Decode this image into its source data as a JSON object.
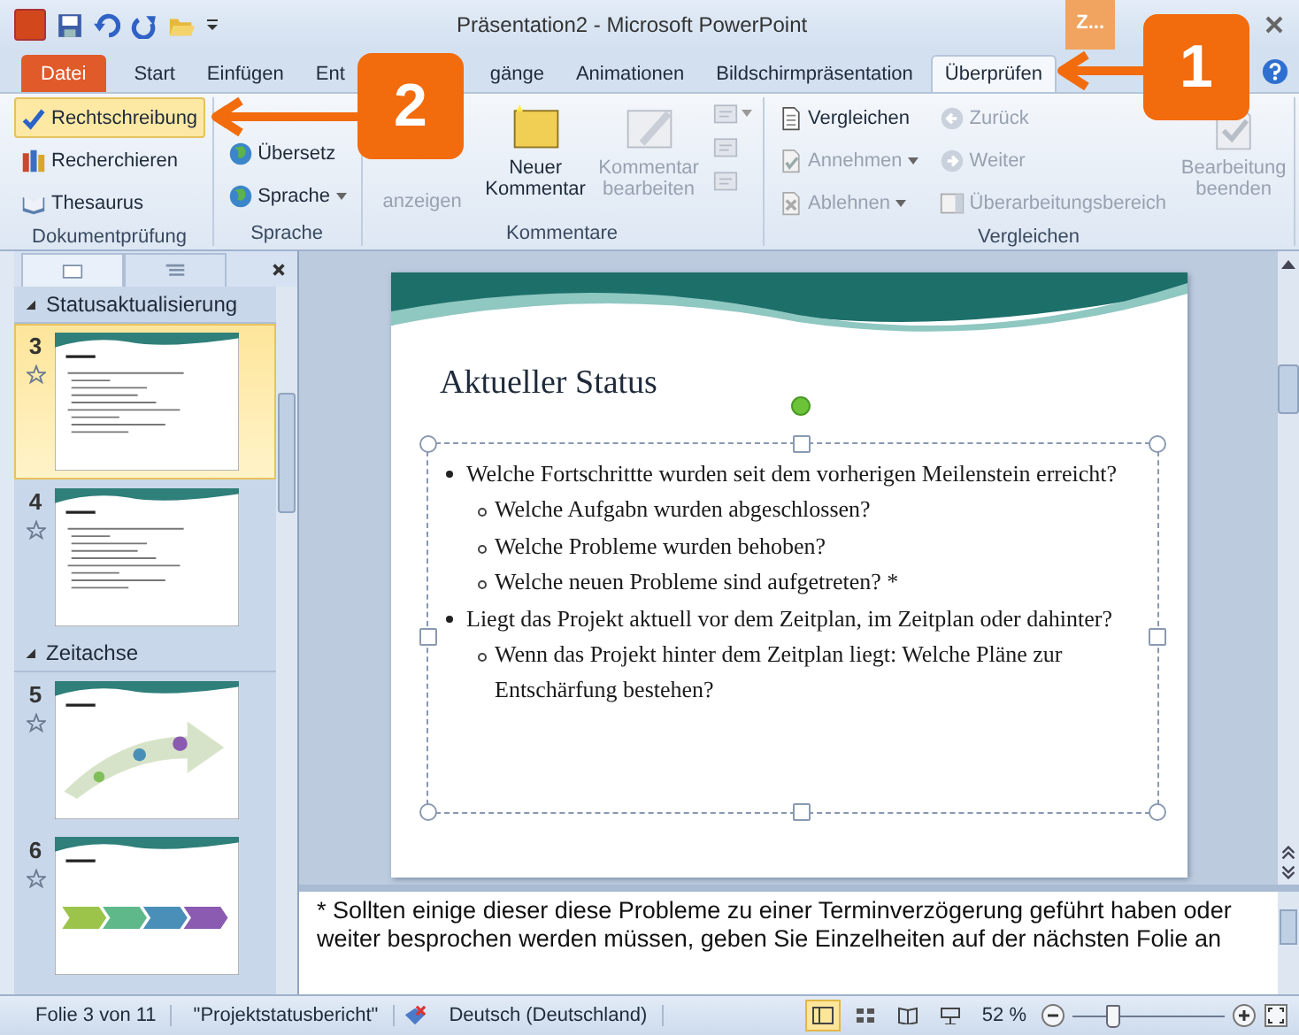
{
  "window": {
    "title": "Präsentation2 - Microsoft PowerPoint",
    "user_badge": "Z..."
  },
  "tabs": [
    {
      "label": "Datei",
      "kind": "file",
      "selected": false
    },
    {
      "label": "Start",
      "kind": "tab",
      "selected": false
    },
    {
      "label": "Einfügen",
      "kind": "tab",
      "selected": false
    },
    {
      "label": "Ent",
      "kind": "tab",
      "selected": false
    },
    {
      "label": "gänge",
      "kind": "tab",
      "selected": false
    },
    {
      "label": "Animationen",
      "kind": "tab",
      "selected": false
    },
    {
      "label": "Bildschirmpräsentation",
      "kind": "tab",
      "selected": false
    },
    {
      "label": "Überprüfen",
      "kind": "tab",
      "selected": true
    }
  ],
  "ribbon_groups": [
    {
      "title": "Dokumentprüfung",
      "columns": [
        [
          {
            "label": "Rechtschreibung",
            "kind": "small",
            "disabled": false,
            "highlighted": true,
            "dropdown": false
          },
          {
            "label": "Recherchieren",
            "kind": "small",
            "disabled": false,
            "highlighted": false,
            "dropdown": false
          },
          {
            "label": "Thesaurus",
            "kind": "small",
            "disabled": false,
            "highlighted": false,
            "dropdown": false
          }
        ]
      ]
    },
    {
      "title": "Sprache",
      "columns": [
        [
          {
            "label": "Übersetz",
            "kind": "small",
            "disabled": false,
            "highlighted": false,
            "dropdown": false
          },
          {
            "label": "Sprache",
            "kind": "small",
            "disabled": false,
            "highlighted": false,
            "dropdown": true
          }
        ]
      ]
    },
    {
      "title": "Kommentare",
      "columns": [
        [
          {
            "label": "anzeigen",
            "kind": "large",
            "disabled": true
          }
        ],
        [
          {
            "label": "Neuer Kommentar",
            "kind": "large",
            "disabled": false
          }
        ],
        [
          {
            "label": "Kommentar bearbeiten",
            "kind": "large",
            "disabled": true
          }
        ],
        [
          {
            "kind": "icon",
            "disabled": true,
            "dropdown": true
          },
          {
            "kind": "icon",
            "disabled": true,
            "dropdown": false
          },
          {
            "kind": "icon",
            "disabled": true,
            "dropdown": false
          }
        ]
      ]
    },
    {
      "title": "Vergleichen",
      "columns": [
        [
          {
            "label": "Vergleichen",
            "kind": "small",
            "disabled": false,
            "highlighted": false,
            "dropdown": false
          },
          {
            "label": "Annehmen",
            "kind": "small",
            "disabled": true,
            "highlighted": false,
            "dropdown": true
          },
          {
            "label": "Ablehnen",
            "kind": "small",
            "disabled": true,
            "highlighted": false,
            "dropdown": true
          }
        ],
        [
          {
            "label": "Zurück",
            "kind": "small",
            "disabled": true,
            "highlighted": false,
            "dropdown": false
          },
          {
            "label": "Weiter",
            "kind": "small",
            "disabled": true,
            "highlighted": false,
            "dropdown": false
          },
          {
            "label": "Überarbeitungsbereich",
            "kind": "small",
            "disabled": true,
            "highlighted": false,
            "dropdown": false
          }
        ],
        [
          {
            "label": "Bearbeitung beenden",
            "kind": "large",
            "disabled": true
          }
        ]
      ]
    }
  ],
  "slide_panel": {
    "sections": [
      {
        "title": "Statusaktualisierung",
        "expanded": true,
        "slides": [
          {
            "number": "3",
            "kind": "bullets",
            "selected": true
          },
          {
            "number": "4",
            "kind": "bullets",
            "selected": false
          }
        ]
      },
      {
        "title": "Zeitachse",
        "expanded": true,
        "slides": [
          {
            "number": "5",
            "kind": "arrow",
            "selected": false
          },
          {
            "number": "6",
            "kind": "chevrons",
            "selected": false
          }
        ]
      }
    ]
  },
  "slide": {
    "title": "Aktueller Status",
    "bullets": [
      {
        "text": "Welche Fortschrittte wurden seit dem vorherigen Meilenstein erreicht?",
        "children": [
          {
            "text": "Welche Aufgabn wurden abgeschlossen?"
          },
          {
            "text": "Welche Probleme wurden behoben?"
          },
          {
            "text": "Welche neuen Probleme sind aufgetreten? *"
          }
        ]
      },
      {
        "text": "Liegt das Projekt aktuell vor dem Zeitplan, im Zeitplan oder dahinter?",
        "children": [
          {
            "text": "Wenn das Projekt hinter dem Zeitplan liegt: Welche Pläne zur Entschärfung bestehen?"
          }
        ]
      }
    ]
  },
  "notes": "* Sollten einige dieser diese Probleme zu einer Terminverzögerung geführt haben oder weiter besprochen werden müssen, geben Sie Einzelheiten auf der nächsten Folie an",
  "status_bar": {
    "slide_info": "Folie 3 von 11",
    "theme": "\"Projektstatusbericht\"",
    "language": "Deutsch (Deutschland)",
    "zoom": "52 %",
    "zoom_level": {
      "level": 0.25
    },
    "views": [
      {
        "selected": true
      },
      {
        "selected": false
      },
      {
        "selected": false
      },
      {
        "selected": false
      }
    ]
  },
  "callouts": [
    {
      "label": "1"
    },
    {
      "label": "2"
    }
  ]
}
